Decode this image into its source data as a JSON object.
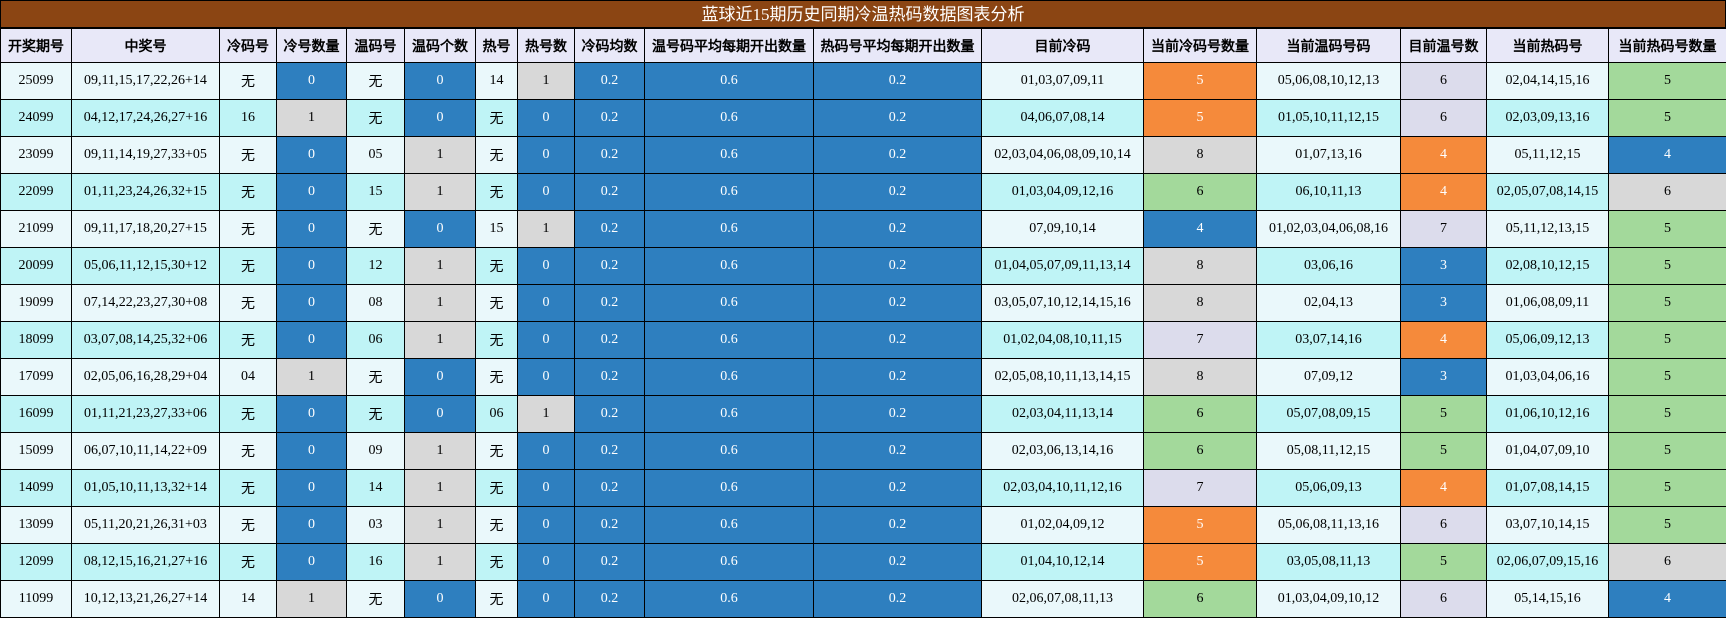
{
  "title": "蓝球近15期历史同期冷温热码数据图表分析",
  "columns": [
    "开奖期号",
    "中奖号",
    "冷码号",
    "冷号数量",
    "温码号",
    "温码个数",
    "热号",
    "热号数",
    "冷码均数",
    "温号码平均每期开出数量",
    "热码号平均每期开出数量",
    "目前冷码",
    "当前冷码号数量",
    "当前温码号码",
    "目前温号数",
    "当前热码号",
    "当前热码号数量"
  ],
  "colors": {
    "dark": "#2e7fbf",
    "grey": "#d8d8d8",
    "orange": "#f58a3b",
    "green": "#a3d99b",
    "lavender": "#dcdcec",
    "title_bg": "#8b4513"
  },
  "rows": [
    [
      "25099",
      "09,11,15,17,22,26+14",
      "无",
      "0",
      "无",
      "0",
      "14",
      "1",
      "0.2",
      "0.6",
      "0.2",
      "01,03,07,09,11",
      "5",
      "05,06,08,10,12,13",
      "6",
      "02,04,14,15,16",
      "5"
    ],
    [
      "24099",
      "04,12,17,24,26,27+16",
      "16",
      "1",
      "无",
      "0",
      "无",
      "0",
      "0.2",
      "0.6",
      "0.2",
      "04,06,07,08,14",
      "5",
      "01,05,10,11,12,15",
      "6",
      "02,03,09,13,16",
      "5"
    ],
    [
      "23099",
      "09,11,14,19,27,33+05",
      "无",
      "0",
      "05",
      "1",
      "无",
      "0",
      "0.2",
      "0.6",
      "0.2",
      "02,03,04,06,08,09,10,14",
      "8",
      "01,07,13,16",
      "4",
      "05,11,12,15",
      "4"
    ],
    [
      "22099",
      "01,11,23,24,26,32+15",
      "无",
      "0",
      "15",
      "1",
      "无",
      "0",
      "0.2",
      "0.6",
      "0.2",
      "01,03,04,09,12,16",
      "6",
      "06,10,11,13",
      "4",
      "02,05,07,08,14,15",
      "6"
    ],
    [
      "21099",
      "09,11,17,18,20,27+15",
      "无",
      "0",
      "无",
      "0",
      "15",
      "1",
      "0.2",
      "0.6",
      "0.2",
      "07,09,10,14",
      "4",
      "01,02,03,04,06,08,16",
      "7",
      "05,11,12,13,15",
      "5"
    ],
    [
      "20099",
      "05,06,11,12,15,30+12",
      "无",
      "0",
      "12",
      "1",
      "无",
      "0",
      "0.2",
      "0.6",
      "0.2",
      "01,04,05,07,09,11,13,14",
      "8",
      "03,06,16",
      "3",
      "02,08,10,12,15",
      "5"
    ],
    [
      "19099",
      "07,14,22,23,27,30+08",
      "无",
      "0",
      "08",
      "1",
      "无",
      "0",
      "0.2",
      "0.6",
      "0.2",
      "03,05,07,10,12,14,15,16",
      "8",
      "02,04,13",
      "3",
      "01,06,08,09,11",
      "5"
    ],
    [
      "18099",
      "03,07,08,14,25,32+06",
      "无",
      "0",
      "06",
      "1",
      "无",
      "0",
      "0.2",
      "0.6",
      "0.2",
      "01,02,04,08,10,11,15",
      "7",
      "03,07,14,16",
      "4",
      "05,06,09,12,13",
      "5"
    ],
    [
      "17099",
      "02,05,06,16,28,29+04",
      "04",
      "1",
      "无",
      "0",
      "无",
      "0",
      "0.2",
      "0.6",
      "0.2",
      "02,05,08,10,11,13,14,15",
      "8",
      "07,09,12",
      "3",
      "01,03,04,06,16",
      "5"
    ],
    [
      "16099",
      "01,11,21,23,27,33+06",
      "无",
      "0",
      "无",
      "0",
      "06",
      "1",
      "0.2",
      "0.6",
      "0.2",
      "02,03,04,11,13,14",
      "6",
      "05,07,08,09,15",
      "5",
      "01,06,10,12,16",
      "5"
    ],
    [
      "15099",
      "06,07,10,11,14,22+09",
      "无",
      "0",
      "09",
      "1",
      "无",
      "0",
      "0.2",
      "0.6",
      "0.2",
      "02,03,06,13,14,16",
      "6",
      "05,08,11,12,15",
      "5",
      "01,04,07,09,10",
      "5"
    ],
    [
      "14099",
      "01,05,10,11,13,32+14",
      "无",
      "0",
      "14",
      "1",
      "无",
      "0",
      "0.2",
      "0.6",
      "0.2",
      "02,03,04,10,11,12,16",
      "7",
      "05,06,09,13",
      "4",
      "01,07,08,14,15",
      "5"
    ],
    [
      "13099",
      "05,11,20,21,26,31+03",
      "无",
      "0",
      "03",
      "1",
      "无",
      "0",
      "0.2",
      "0.6",
      "0.2",
      "01,02,04,09,12",
      "5",
      "05,06,08,11,13,16",
      "6",
      "03,07,10,14,15",
      "5"
    ],
    [
      "12099",
      "08,12,15,16,21,27+16",
      "无",
      "0",
      "16",
      "1",
      "无",
      "0",
      "0.2",
      "0.6",
      "0.2",
      "01,04,10,12,14",
      "5",
      "03,05,08,11,13",
      "5",
      "02,06,07,09,15,16",
      "6"
    ],
    [
      "11099",
      "10,12,13,21,26,27+14",
      "14",
      "1",
      "无",
      "0",
      "无",
      "0",
      "0.2",
      "0.6",
      "0.2",
      "02,06,07,08,11,13",
      "6",
      "01,03,04,09,10,12",
      "6",
      "05,14,15,16",
      "4"
    ]
  ]
}
